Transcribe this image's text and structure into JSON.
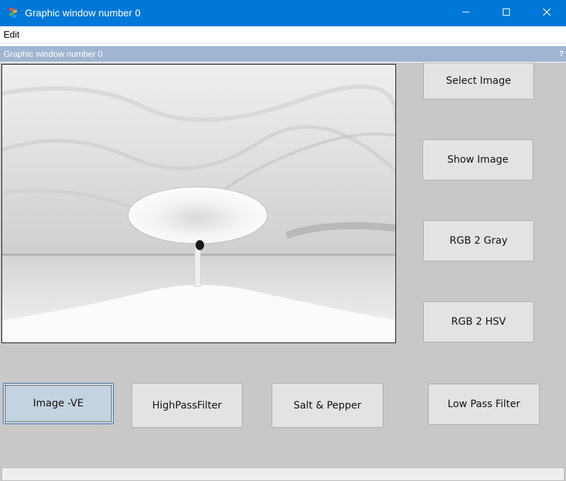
{
  "window": {
    "title": "Graphic window number 0",
    "icon": "scilab-icon",
    "controls": [
      "minimize-icon",
      "maximize-icon",
      "close-icon"
    ]
  },
  "menu": {
    "items": [
      "Edit"
    ]
  },
  "figure": {
    "title": "Graphic window number 0",
    "help_label": "?"
  },
  "image_panel": {
    "content": "negative-image-tree-landscape"
  },
  "buttons": {
    "select_image": "Select Image",
    "show_image": "Show Image",
    "rgb2gray": "RGB 2 Gray",
    "rgb2hsv": "RGB 2 HSV",
    "image_negative": "Image -VE",
    "high_pass": "HighPassFilter",
    "salt_pepper": "Salt & Pepper",
    "low_pass": "Low Pass Filter"
  },
  "colors": {
    "titlebar": "#0078d7",
    "figure_header": "#9fb5d1",
    "background": "#c8c8c8",
    "button": "#e3e3e3",
    "button_selected": "#c5d2df"
  }
}
